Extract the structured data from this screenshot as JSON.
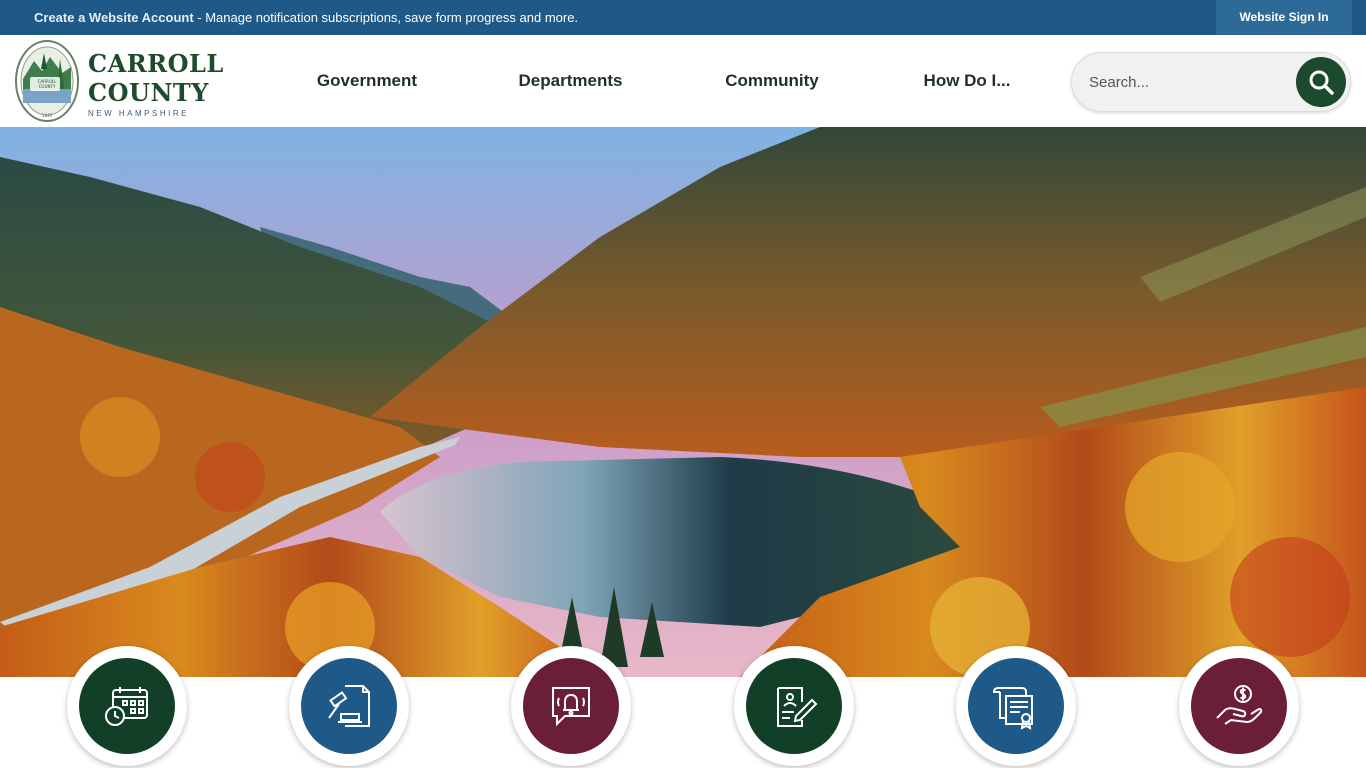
{
  "topbar": {
    "create_link": "Create a Website Account",
    "message": " - Manage notification subscriptions, save form progress and more.",
    "signin_label": "Website Sign In"
  },
  "logo": {
    "line1": "CARROLL",
    "line2": "COUNTY",
    "subtitle": "NEW HAMPSHIRE",
    "seal_text_top": "STATE OF NEW HAMPSHIRE",
    "seal_text_center_1": "CARROLL",
    "seal_text_center_2": "COUNTY",
    "seal_year": "1840"
  },
  "nav": {
    "items": [
      {
        "label": "Government"
      },
      {
        "label": "Departments"
      },
      {
        "label": "Community"
      },
      {
        "label": "How Do I..."
      }
    ]
  },
  "search": {
    "placeholder": "Search..."
  },
  "quick_links": [
    {
      "icon": "calendar-clock-icon",
      "color": "#123f27"
    },
    {
      "icon": "gavel-document-icon",
      "color": "#1e5987"
    },
    {
      "icon": "notification-bell-icon",
      "color": "#6b1f36"
    },
    {
      "icon": "form-pen-icon",
      "color": "#123f27"
    },
    {
      "icon": "certificate-scroll-icon",
      "color": "#1e5987"
    },
    {
      "icon": "hand-money-icon",
      "color": "#6b1f36"
    }
  ],
  "colors": {
    "topbar": "#1e5987",
    "brand_green": "#1b4a2c",
    "maroon": "#6b1f36"
  }
}
